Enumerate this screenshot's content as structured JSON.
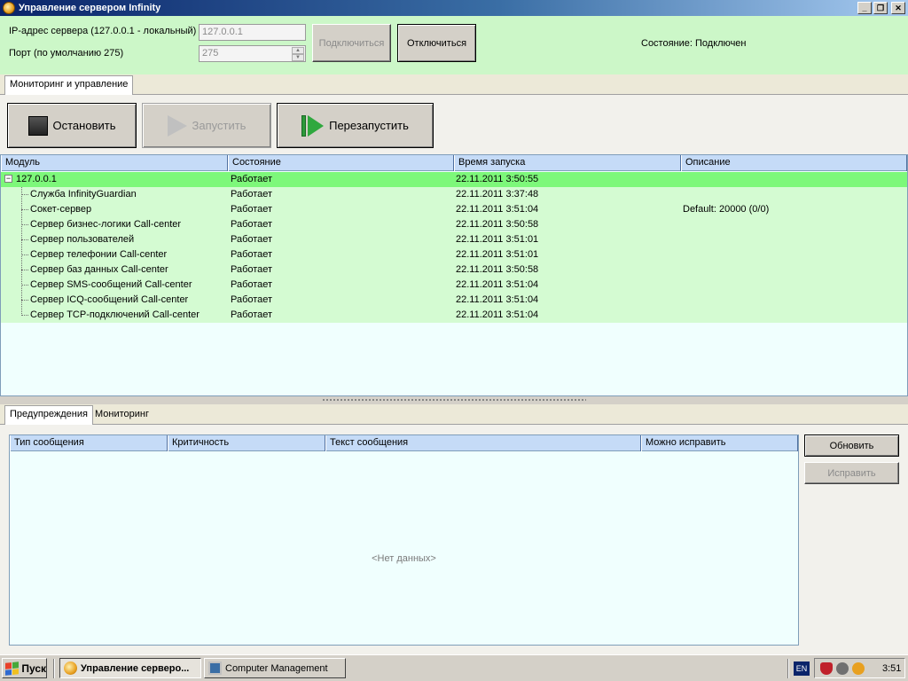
{
  "window": {
    "title": "Управление сервером Infinity",
    "controls": [
      "_",
      "❐",
      "✕"
    ]
  },
  "connection": {
    "ip_label": "IP-адрес сервера (127.0.0.1 - локальный)",
    "ip_value": "127.0.0.1",
    "port_label": "Порт (по умолчанию 275)",
    "port_value": "275",
    "connect_label": "Подключиться",
    "disconnect_label": "Отключиться",
    "status_text": "Состояние: Подключен"
  },
  "tabs_top": [
    {
      "label": "Мониторинг и управление",
      "active": true
    }
  ],
  "toolbar": {
    "stop_label": "Остановить",
    "start_label": "Запустить",
    "restart_label": "Перезапустить"
  },
  "modules": {
    "columns": [
      "Модуль",
      "Состояние",
      "Время запуска",
      "Описание"
    ],
    "root": {
      "name": "127.0.0.1",
      "state": "Работает",
      "started": "22.11.2011 3:50:55",
      "description": "",
      "expander": "−"
    },
    "rows": [
      {
        "name": "Служба InfinityGuardian",
        "state": "Работает",
        "started": "22.11.2011 3:37:48",
        "description": ""
      },
      {
        "name": "Сокет-сервер",
        "state": "Работает",
        "started": "22.11.2011 3:51:04",
        "description": "Default: 20000 (0/0)"
      },
      {
        "name": "Сервер бизнес-логики Call-center",
        "state": "Работает",
        "started": "22.11.2011 3:50:58",
        "description": ""
      },
      {
        "name": "Сервер пользователей",
        "state": "Работает",
        "started": "22.11.2011 3:51:01",
        "description": ""
      },
      {
        "name": "Сервер телефонии Call-center",
        "state": "Работает",
        "started": "22.11.2011 3:51:01",
        "description": ""
      },
      {
        "name": "Сервер баз данных Call-center",
        "state": "Работает",
        "started": "22.11.2011 3:50:58",
        "description": ""
      },
      {
        "name": "Сервер SMS-сообщений Call-center",
        "state": "Работает",
        "started": "22.11.2011 3:51:04",
        "description": ""
      },
      {
        "name": "Сервер ICQ-сообщений Call-center",
        "state": "Работает",
        "started": "22.11.2011 3:51:04",
        "description": ""
      },
      {
        "name": "Сервер TCP-подключений Call-center",
        "state": "Работает",
        "started": "22.11.2011 3:51:04",
        "description": ""
      }
    ]
  },
  "tabs_bottom": [
    {
      "label": "Предупреждения",
      "active": true
    },
    {
      "label": "Мониторинг",
      "active": false
    }
  ],
  "warnings": {
    "columns": [
      "Тип сообщения",
      "Критичность",
      "Текст сообщения",
      "Можно исправить"
    ],
    "empty_text": "<Нет данных>",
    "refresh_label": "Обновить",
    "fix_label": "Исправить"
  },
  "taskbar": {
    "start_label": "Пуск",
    "tasks": [
      {
        "label": "Управление сервером Infinity",
        "short": "Управление сервеpo...",
        "active": true,
        "icon": "infinity-app-icon"
      },
      {
        "label": "Computer Management",
        "short": "Computer Management",
        "active": false,
        "icon": "computer-management-icon"
      }
    ],
    "lang": "EN",
    "clock": "3:51"
  },
  "colors": {
    "connection_bg": "#ccf7c8",
    "root_row": "#7df87a",
    "module_row": "#d4fbd2",
    "grid_header": "#c5dbf7"
  }
}
